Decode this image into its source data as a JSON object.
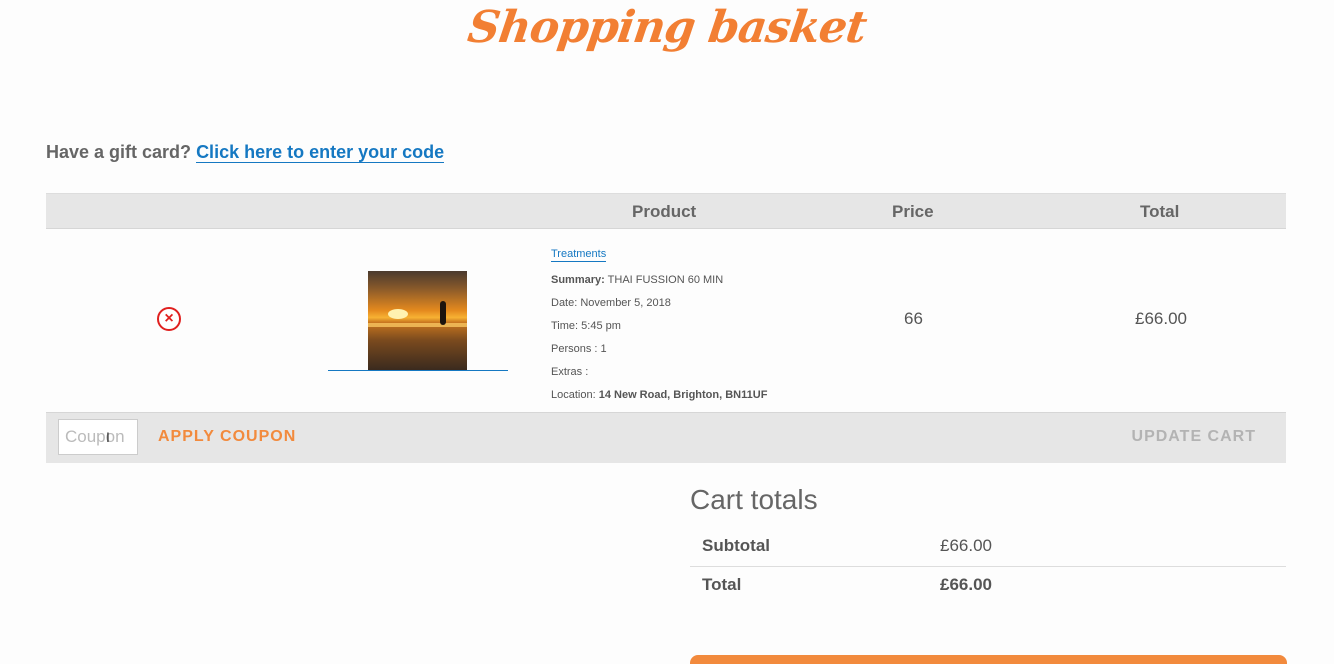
{
  "page": {
    "title": "Shopping basket"
  },
  "gift": {
    "prompt": "Have a gift card?",
    "link": "Click here to enter your code"
  },
  "table": {
    "headers": {
      "product": "Product",
      "price": "Price",
      "total": "Total"
    },
    "item": {
      "remove_symbol": "×",
      "category": "Treatments",
      "summary_label": "Summary:",
      "summary_value": "THAI FUSSION 60 MIN",
      "date": "Date: November 5, 2018",
      "time": "Time: 5:45 pm",
      "persons": "Persons : 1",
      "extras": "Extras :",
      "location_label": "Location:",
      "location_value": "14 New Road, Brighton, BN11UF",
      "price": "66",
      "total": "£66.00"
    }
  },
  "actions": {
    "coupon_placeholder": "Coupon",
    "apply": "APPLY COUPON",
    "update": "UPDATE CART"
  },
  "totals": {
    "heading": "Cart totals",
    "subtotal_label": "Subtotal",
    "subtotal_value": "£66.00",
    "total_label": "Total",
    "total_value": "£66.00"
  },
  "colors": {
    "accent": "#f27f33",
    "link": "#1578c2",
    "remove": "#e0201f"
  }
}
